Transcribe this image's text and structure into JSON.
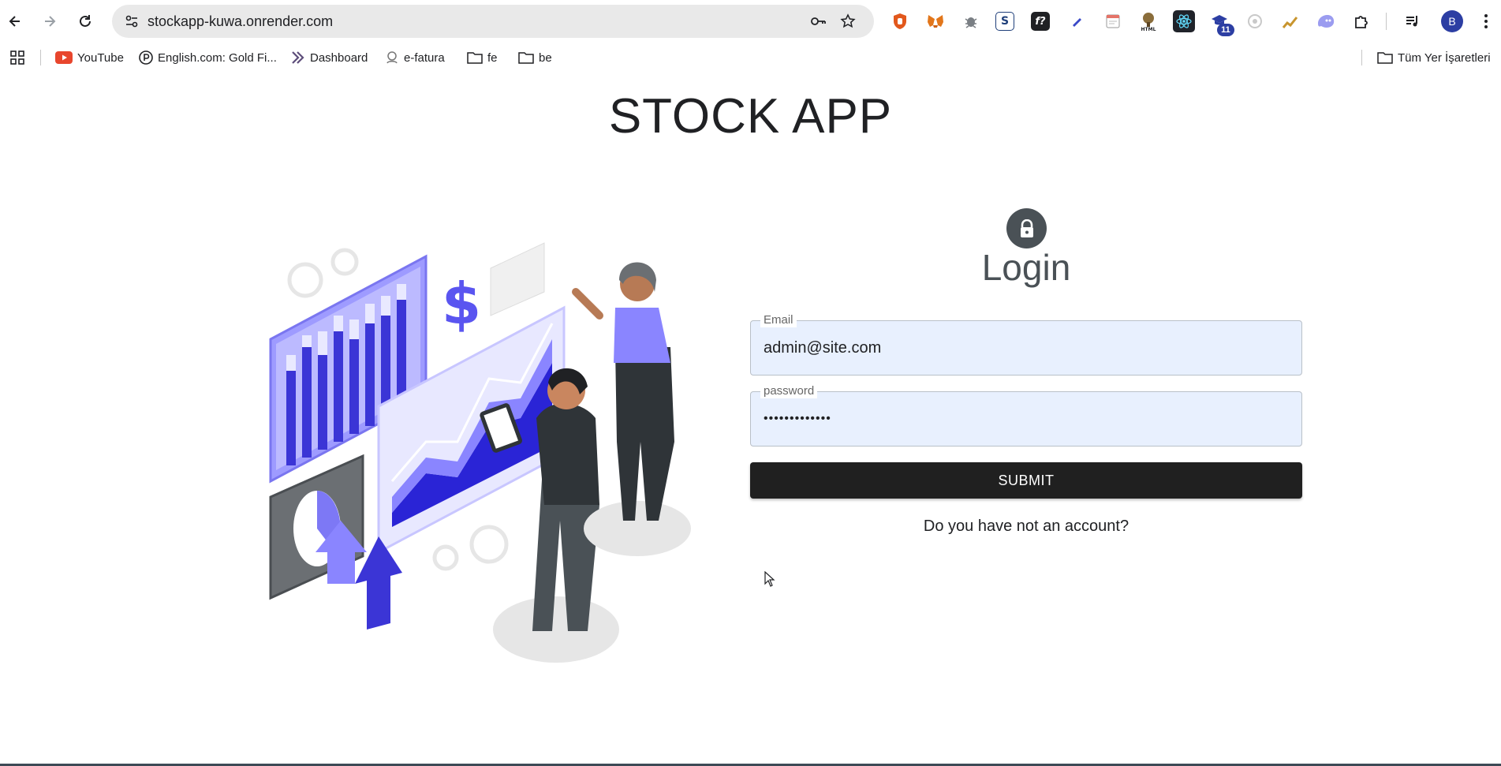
{
  "browser": {
    "url": "stockapp-kuwa.onrender.com",
    "extensions_badge": "11",
    "profile_initial": "B"
  },
  "bookmarks": {
    "items": [
      {
        "label": "YouTube"
      },
      {
        "label": "English.com: Gold Fi..."
      },
      {
        "label": "Dashboard"
      },
      {
        "label": "e-fatura"
      },
      {
        "label": "fe"
      },
      {
        "label": "be"
      }
    ],
    "all_bookmarks": "Tüm Yer İşaretleri"
  },
  "page": {
    "title": "STOCK APP"
  },
  "login": {
    "heading": "Login",
    "email_label": "Email",
    "email_value": "admin@site.com",
    "password_label": "password",
    "password_value": "•••••••••••••",
    "submit_label": "SUBMIT",
    "signup_link": "Do you have not an account?"
  },
  "colors": {
    "accent_purple": "#6c63ff",
    "dark_button": "#202020",
    "autofill_bg": "#e8f0fe",
    "lock_circle": "#4a5156"
  }
}
